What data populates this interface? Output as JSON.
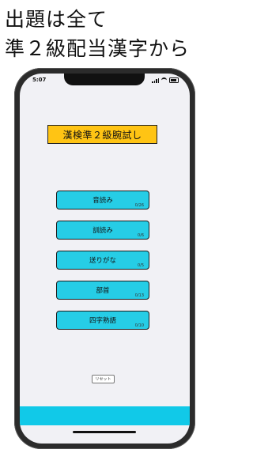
{
  "promo": {
    "line1": "出題は全て",
    "line2": "準２級配当漢字から"
  },
  "status_bar": {
    "time": "5:07",
    "icons": [
      "signal-icon",
      "wifi-icon",
      "battery-icon"
    ]
  },
  "app": {
    "title": "漢検準２級腕試し",
    "title_color": "#ffc414",
    "button_color": "#26cde6",
    "menu": [
      {
        "label": "音読み",
        "count": "0/26"
      },
      {
        "label": "訓読み",
        "count": "0/6"
      },
      {
        "label": "送りがな",
        "count": "0/5"
      },
      {
        "label": "部首",
        "count": "0/13"
      },
      {
        "label": "四字熟語",
        "count": "0/10"
      }
    ],
    "reset_label": "リセット",
    "bottom_bar_color": "#11c9e8"
  }
}
